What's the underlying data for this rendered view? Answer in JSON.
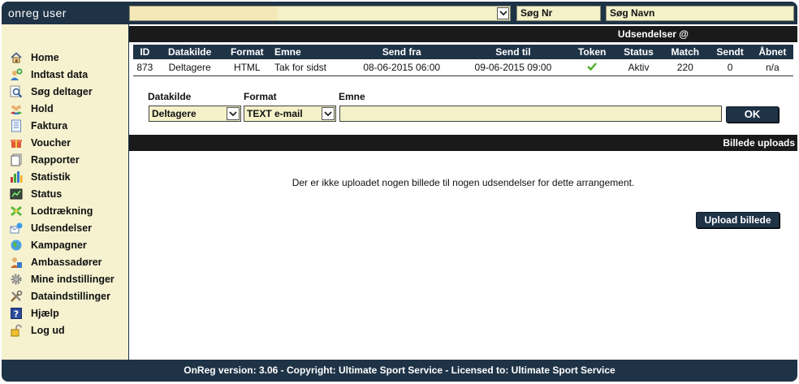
{
  "app": {
    "title": "onreg user"
  },
  "topbar": {
    "search_nr": "Søg Nr",
    "search_name": "Søg Navn"
  },
  "sidebar": {
    "items": [
      {
        "label": "Home",
        "icon": "home-icon"
      },
      {
        "label": "Indtast data",
        "icon": "user-add-icon"
      },
      {
        "label": "Søg deltager",
        "icon": "search-icon"
      },
      {
        "label": "Hold",
        "icon": "group-icon"
      },
      {
        "label": "Faktura",
        "icon": "invoice-icon"
      },
      {
        "label": "Voucher",
        "icon": "gift-icon"
      },
      {
        "label": "Rapporter",
        "icon": "report-icon"
      },
      {
        "label": "Statistik",
        "icon": "bar-chart-icon"
      },
      {
        "label": "Status",
        "icon": "status-icon"
      },
      {
        "label": "Lodtrækning",
        "icon": "lottery-icon"
      },
      {
        "label": "Udsendelser",
        "icon": "broadcast-icon"
      },
      {
        "label": "Kampagner",
        "icon": "globe-icon"
      },
      {
        "label": "Ambassadører",
        "icon": "ambassador-icon"
      },
      {
        "label": "Mine indstillinger",
        "icon": "gear-icon"
      },
      {
        "label": "Dataindstillinger",
        "icon": "tools-icon"
      },
      {
        "label": "Hjælp",
        "icon": "help-icon"
      },
      {
        "label": "Log ud",
        "icon": "lock-icon"
      }
    ]
  },
  "udsendelser": {
    "title": "Udsendelser @",
    "columns": [
      "ID",
      "Datakilde",
      "Format",
      "Emne",
      "Send fra",
      "Send til",
      "Token",
      "Status",
      "Match",
      "Sendt",
      "Åbnet"
    ],
    "rows": [
      {
        "id": "873",
        "datakilde": "Deltagere",
        "format": "HTML",
        "emne": "Tak for sidst",
        "send_fra": "08-06-2015 06:00",
        "send_til": "09-06-2015 09:00",
        "token": "checkmark-icon",
        "status": "Aktiv",
        "match": "220",
        "sendt": "0",
        "aabnet": "n/a"
      }
    ]
  },
  "form": {
    "datakilde_label": "Datakilde",
    "format_label": "Format",
    "emne_label": "Emne",
    "datakilde_value": "Deltagere",
    "format_value": "TEXT e-mail",
    "emne_value": "",
    "ok_label": "OK"
  },
  "billeder": {
    "title": "Billede uploads",
    "empty_text": "Der er ikke uploadet nogen billede til nogen udsendelser for dette arrangement.",
    "upload_label": "Upload billede"
  },
  "footer": {
    "text": "OnReg version: 3.06 - Copyright: Ultimate Sport Service - Licensed to: Ultimate Sport Service"
  },
  "colors": {
    "navy": "#1f3347",
    "sidebar_bg": "#f6f2d0",
    "field_bg": "#f4f1c9",
    "header_black": "#1a1a1a",
    "check_green": "#4caf2a"
  }
}
